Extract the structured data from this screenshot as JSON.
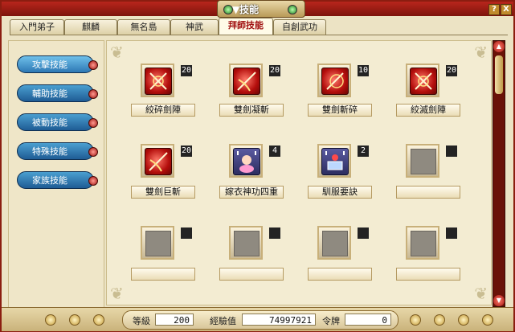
{
  "window": {
    "title": "技能",
    "help_label": "?",
    "close_label": "X"
  },
  "tabs": [
    {
      "label": "入門弟子",
      "active": false
    },
    {
      "label": "麒麟",
      "active": false
    },
    {
      "label": "無名島",
      "active": false
    },
    {
      "label": "神武",
      "active": false
    },
    {
      "label": "拜師技能",
      "active": true
    },
    {
      "label": "自創武功",
      "active": false
    }
  ],
  "categories": [
    {
      "label": "攻擊技能",
      "active": true
    },
    {
      "label": "輔助技能",
      "active": false
    },
    {
      "label": "被動技能",
      "active": false
    },
    {
      "label": "特殊技能",
      "active": false
    },
    {
      "label": "家族技能",
      "active": false
    }
  ],
  "skills": [
    {
      "name": "絞碎劍陣",
      "level": "20",
      "icon": "crossed-swords-icon"
    },
    {
      "name": "雙劍凝斬",
      "level": "20",
      "icon": "sword-slash-icon"
    },
    {
      "name": "雙劍斬碎",
      "level": "10",
      "icon": "sword-burst-icon"
    },
    {
      "name": "絞滅劍陣",
      "level": "20",
      "icon": "crossed-swords-icon"
    },
    {
      "name": "雙劍巨斬",
      "level": "20",
      "icon": "sword-slash-icon"
    },
    {
      "name": "嫁衣神功四重",
      "level": "4",
      "icon": "character-buff-icon"
    },
    {
      "name": "馴服要訣",
      "level": "2",
      "icon": "book-buff-icon"
    },
    {
      "name": "",
      "level": "",
      "icon": "empty-slot"
    },
    {
      "name": "",
      "level": "",
      "icon": "empty-slot"
    },
    {
      "name": "",
      "level": "",
      "icon": "empty-slot"
    },
    {
      "name": "",
      "level": "",
      "icon": "empty-slot"
    },
    {
      "name": "",
      "level": "",
      "icon": "empty-slot"
    }
  ],
  "stats": {
    "level_label": "等級",
    "level_value": "200",
    "exp_label": "經驗值",
    "exp_value": "74997921",
    "token_label": "令牌",
    "token_value": "0"
  },
  "colors": {
    "frame": "#8b1d10",
    "panel": "#ece3c4",
    "category_button": "#2d78b4",
    "active_tab_text": "#a01010"
  }
}
